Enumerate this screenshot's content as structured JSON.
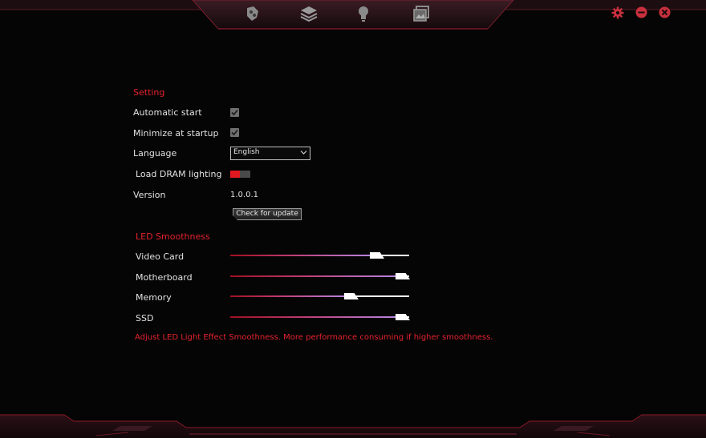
{
  "nav": {
    "items": [
      {
        "icon": "palette-icon"
      },
      {
        "icon": "layers-icon"
      },
      {
        "icon": "lightbulb-icon"
      },
      {
        "icon": "gallery-icon"
      }
    ]
  },
  "window_controls": {
    "settings_icon": "gear-icon",
    "minimize_icon": "minimize-icon",
    "close_icon": "close-icon"
  },
  "setting": {
    "title": "Setting",
    "automatic_start_label": "Automatic start",
    "automatic_start_checked": true,
    "minimize_label": "Minimize at startup",
    "minimize_checked": true,
    "language_label": "Language",
    "language_value": "English",
    "load_dram_label": "Load DRAM lighting",
    "load_dram_on": true,
    "version_label": "Version",
    "version_value": "1.0.0.1",
    "update_button": "Check for update"
  },
  "led": {
    "title": "LED Smoothness",
    "sliders": [
      {
        "label": "Video Card",
        "value": 0.85
      },
      {
        "label": "Motherboard",
        "value": 1.0
      },
      {
        "label": "Memory",
        "value": 0.7
      },
      {
        "label": "SSD",
        "value": 1.0
      }
    ],
    "hint": "Adjust LED Light Effect Smoothness. More performance consuming if higher smoothness."
  },
  "colors": {
    "accent": "#e4222e",
    "background": "#050505"
  }
}
